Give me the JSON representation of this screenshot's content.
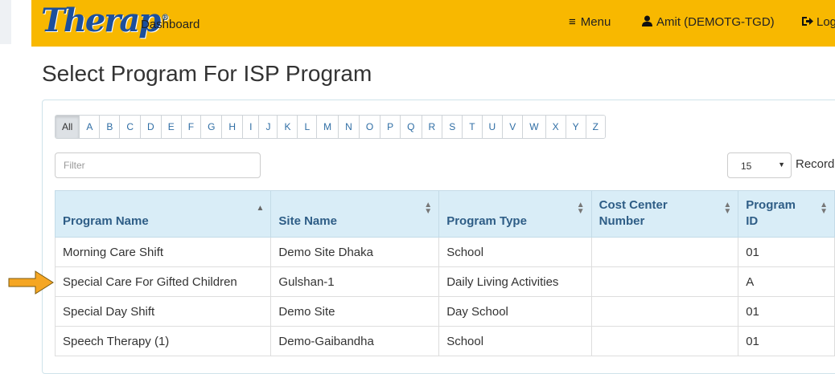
{
  "nav": {
    "logo_text": "Therap",
    "logo_mark": "®",
    "dashboard_label": "Dashboard",
    "menu_label": "Menu",
    "user_label": "Amit (DEMOTG-TGD)",
    "logout_label": "Log"
  },
  "page": {
    "title": "Select Program For ISP Program"
  },
  "alphabet": [
    "All",
    "A",
    "B",
    "C",
    "D",
    "E",
    "F",
    "G",
    "H",
    "I",
    "J",
    "K",
    "L",
    "M",
    "N",
    "O",
    "P",
    "Q",
    "R",
    "S",
    "T",
    "U",
    "V",
    "W",
    "X",
    "Y",
    "Z"
  ],
  "alphabet_selected": "All",
  "filter": {
    "placeholder": "Filter",
    "value": ""
  },
  "records": {
    "selected": "15",
    "label": "Record"
  },
  "table": {
    "columns": [
      {
        "label": "Program Name",
        "sort": "asc"
      },
      {
        "label": "Site Name",
        "sort": "both"
      },
      {
        "label": "Program Type",
        "sort": "both"
      },
      {
        "label": "Cost Center Number",
        "sort": "both"
      },
      {
        "label": "Program ID",
        "sort": "both"
      }
    ],
    "rows": [
      [
        "Morning Care Shift",
        "Demo Site Dhaka",
        "School",
        "",
        "01"
      ],
      [
        "Special Care For Gifted Children",
        "Gulshan-1",
        "Daily Living Activities",
        "",
        "A"
      ],
      [
        "Special Day Shift",
        "Demo Site",
        "Day School",
        "",
        "01"
      ],
      [
        "Speech Therapy (1)",
        "Demo-Gaibandha",
        "School",
        "",
        "01"
      ]
    ]
  },
  "annotation": {
    "arrow_color": "#f5a623",
    "points_to_row": 1
  },
  "colors": {
    "navbar": "#f8b800",
    "header_bg": "#d9edf7",
    "link": "#2e6da4"
  }
}
